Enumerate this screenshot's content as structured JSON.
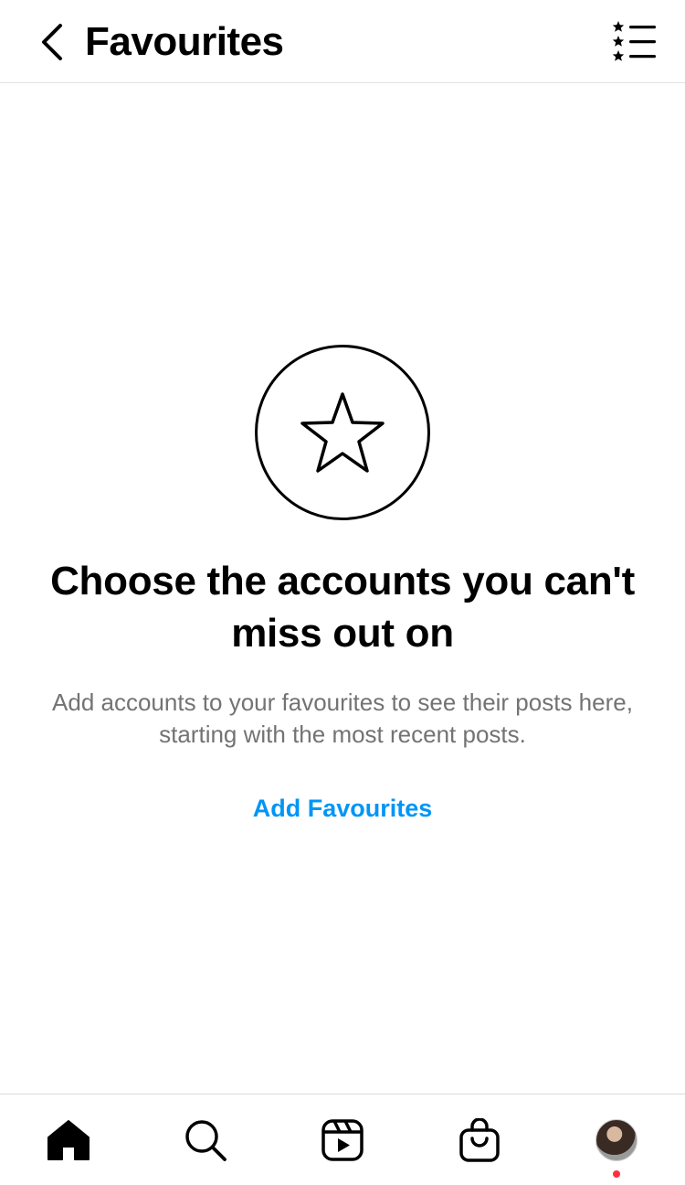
{
  "header": {
    "title": "Favourites",
    "back_icon": "chevron-left-icon",
    "list_icon": "star-list-icon"
  },
  "empty_state": {
    "icon": "star-icon",
    "headline": "Choose the accounts you can't miss out on",
    "body": "Add accounts to your favourites to see their posts here, starting with the most recent posts.",
    "action_label": "Add Favourites"
  },
  "tabbar": {
    "items": [
      {
        "name": "home",
        "icon": "home-icon"
      },
      {
        "name": "search",
        "icon": "search-icon"
      },
      {
        "name": "reels",
        "icon": "reels-icon"
      },
      {
        "name": "shop",
        "icon": "shopping-bag-icon"
      },
      {
        "name": "profile",
        "icon": "avatar"
      }
    ]
  },
  "colors": {
    "link": "#0095f6",
    "secondary_text": "#737373",
    "notification": "#ff3040"
  }
}
